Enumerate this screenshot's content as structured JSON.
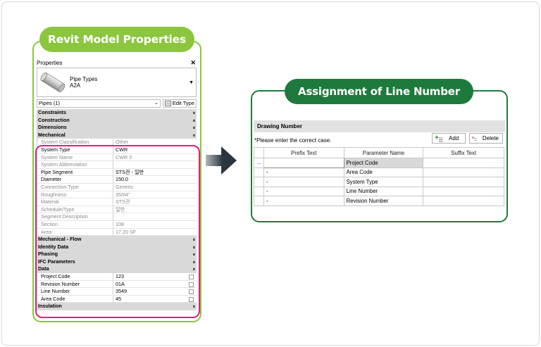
{
  "left_panel": {
    "title": "Revit Model Properties",
    "properties_header": "Properties",
    "close_glyph": "✕",
    "type_family": "Pipe Types",
    "type_name": "A2A",
    "selector_value": "Pipes (1)",
    "edit_type_label": "Edit Type",
    "rows": [
      {
        "kind": "group",
        "label": "Constraints",
        "chevron": "»"
      },
      {
        "kind": "group",
        "label": "Construction",
        "chevron": "»"
      },
      {
        "kind": "group",
        "label": "Dimensions",
        "chevron": "»"
      },
      {
        "kind": "group",
        "label": "Mechanical",
        "chevron": "«"
      },
      {
        "kind": "prop",
        "name": "System Classification",
        "value": "Other",
        "tone": "grey"
      },
      {
        "kind": "prop",
        "name": "System Type",
        "value": "CWR",
        "tone": "black"
      },
      {
        "kind": "prop",
        "name": "System Name",
        "value": "CWR 3",
        "tone": "grey"
      },
      {
        "kind": "prop",
        "name": "System Abbreviation",
        "value": "",
        "tone": "grey"
      },
      {
        "kind": "prop",
        "name": "Pipe Segment",
        "value": "STS관 - 일반",
        "tone": "black"
      },
      {
        "kind": "prop",
        "name": "Diameter",
        "value": "150.0",
        "tone": "black"
      },
      {
        "kind": "prop",
        "name": "Connection Type",
        "value": "Generic",
        "tone": "grey"
      },
      {
        "kind": "prop",
        "name": "Roughness",
        "value": "35/64\"",
        "tone": "grey"
      },
      {
        "kind": "prop",
        "name": "Material",
        "value": "STS관",
        "tone": "grey"
      },
      {
        "kind": "prop",
        "name": "Schedule/Type",
        "value": "일반",
        "tone": "grey"
      },
      {
        "kind": "prop",
        "name": "Segment Description",
        "value": "",
        "tone": "grey"
      },
      {
        "kind": "prop",
        "name": "Section",
        "value": "108",
        "tone": "grey"
      },
      {
        "kind": "prop",
        "name": "Area",
        "value": "17.20 SF",
        "tone": "grey"
      },
      {
        "kind": "group",
        "label": "Mechanical - Flow",
        "chevron": "»"
      },
      {
        "kind": "group",
        "label": "Identity Data",
        "chevron": "»"
      },
      {
        "kind": "group",
        "label": "Phasing",
        "chevron": "»"
      },
      {
        "kind": "group",
        "label": "IFC Parameters",
        "chevron": "»"
      },
      {
        "kind": "group",
        "label": "Data",
        "chevron": "«"
      },
      {
        "kind": "prop",
        "name": "Project Code",
        "value": "123",
        "tone": "black",
        "checkbox": true
      },
      {
        "kind": "prop",
        "name": "Revision Number",
        "value": "01A",
        "tone": "black",
        "checkbox": true
      },
      {
        "kind": "prop",
        "name": "Line Number",
        "value": "3549",
        "tone": "black",
        "checkbox": true
      },
      {
        "kind": "prop",
        "name": "Area Code",
        "value": "45",
        "tone": "black",
        "checkbox": true
      },
      {
        "kind": "group",
        "label": "Insulation",
        "chevron": "»"
      }
    ]
  },
  "right_panel": {
    "title": "Assignment of Line Number",
    "section_label": "Drawing Number",
    "hint": "*Please enter the correct case.",
    "add_label": "Add",
    "delete_label": "Delete",
    "columns": [
      "Prefix Text",
      "Parameter Name",
      "Suffix Text"
    ],
    "rows": [
      {
        "marker": "→",
        "prefix": "",
        "parameter": "Project Code",
        "suffix": "",
        "selected": true
      },
      {
        "marker": "",
        "prefix": "-",
        "parameter": "Area Code",
        "suffix": ""
      },
      {
        "marker": "",
        "prefix": "-",
        "parameter": "System Type",
        "suffix": ""
      },
      {
        "marker": "",
        "prefix": "-",
        "parameter": "Line Number",
        "suffix": ""
      },
      {
        "marker": "",
        "prefix": "-",
        "parameter": "Revision Number",
        "suffix": ""
      }
    ]
  },
  "colors": {
    "left_accent": "#8cc63f",
    "right_accent": "#1e7a3c",
    "highlight": "#e0207a",
    "arrow": "#2b3540"
  }
}
